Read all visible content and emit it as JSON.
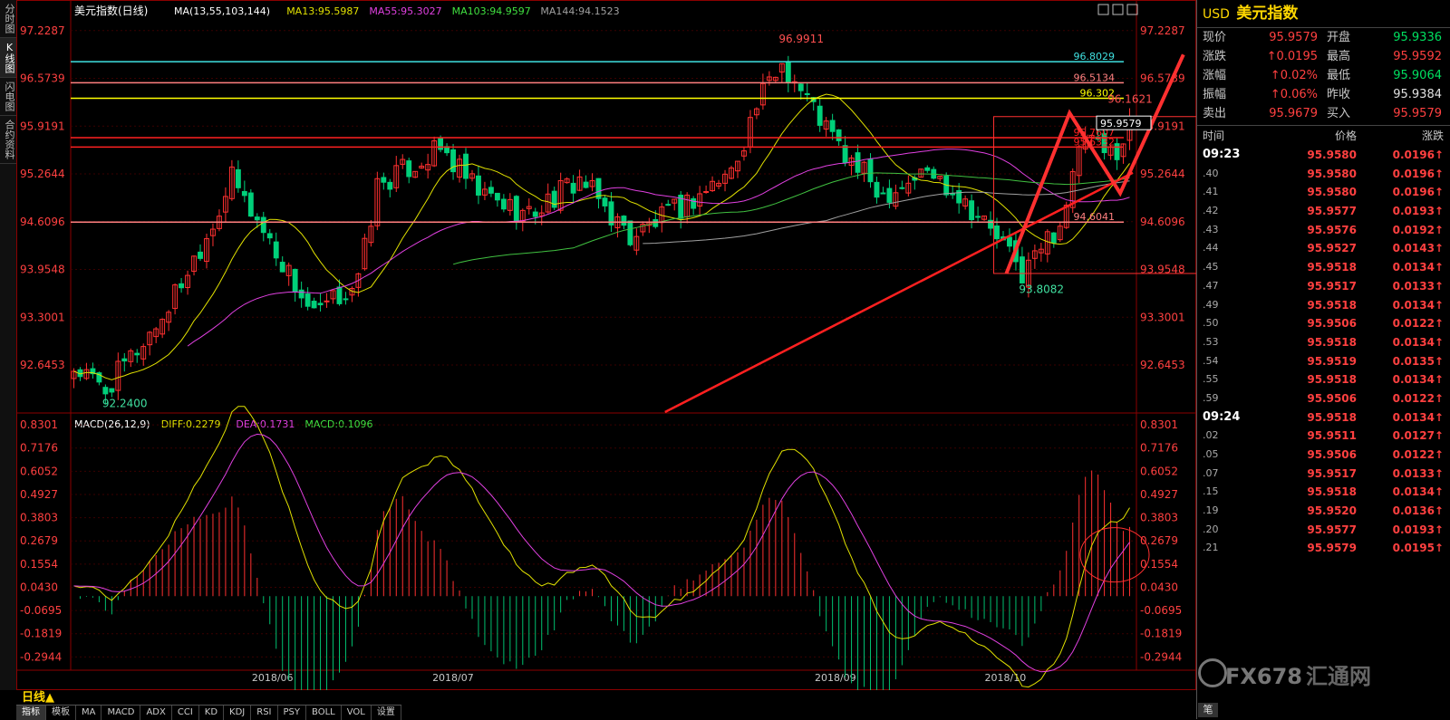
{
  "left_tabs": [
    "分时图",
    "K线图",
    "闪电图",
    "合约资料"
  ],
  "top_icons": [
    "window-icon",
    "restore-icon",
    "close-icon"
  ],
  "chart_data": [
    {
      "type": "candlestick",
      "title": "美元指数(日线)",
      "indicator_legend": [
        {
          "text": "MA(13,55,103,144)",
          "color": "#ffffff"
        },
        {
          "text": "MA13:95.5987",
          "color": "#e0e000"
        },
        {
          "text": "MA55:95.3027",
          "color": "#e040e0"
        },
        {
          "text": "MA103:94.9597",
          "color": "#40e040"
        },
        {
          "text": "MA144:94.1523",
          "color": "#a0a0a0"
        }
      ],
      "y_ticks": [
        "97.2287",
        "96.5739",
        "95.9191",
        "95.2644",
        "94.6096",
        "93.9548",
        "93.3001",
        "92.6453"
      ],
      "ylim": [
        92.0,
        97.4
      ],
      "x_labels": [
        "2018/06",
        "2018/07",
        "2018/09",
        "2018/10"
      ],
      "annotations": [
        {
          "text": "96.9911",
          "value": 96.9911
        },
        {
          "text": "92.2400",
          "value": 92.24
        },
        {
          "text": "93.8082",
          "value": 93.8082
        },
        {
          "text": "96.1621",
          "value": 96.1621
        }
      ],
      "horizontal_levels": [
        {
          "label": "96.8029",
          "value": 96.8029,
          "color": "#40e0e0"
        },
        {
          "label": "96.5134",
          "value": 96.5134,
          "color": "#ff8080"
        },
        {
          "label": "96.302",
          "value": 96.302,
          "color": "#ffff00"
        },
        {
          "label": "95.7607",
          "value": 95.7607,
          "color": "#ff2020"
        },
        {
          "label": "95.6332",
          "value": 95.6332,
          "color": "#ff2020"
        },
        {
          "label": "94.6041",
          "value": 94.6041,
          "color": "#ff8080"
        }
      ],
      "current_price_label": "95.9579",
      "colors": {
        "up": "#ff3030",
        "down": "#00d07a",
        "grid": "#8b0000"
      }
    },
    {
      "type": "macd",
      "legend": [
        {
          "text": "MACD(26,12,9)",
          "color": "#ffffff"
        },
        {
          "text": "DIFF:0.2279",
          "color": "#e0e000"
        },
        {
          "text": "DEA:0.1731",
          "color": "#e040e0"
        },
        {
          "text": "MACD:0.1096",
          "color": "#40e040"
        }
      ],
      "y_ticks": [
        "0.8301",
        "0.7176",
        "0.6052",
        "0.4927",
        "0.3803",
        "0.2679",
        "0.1554",
        "0.0430",
        "-0.0695",
        "-0.1819",
        "-0.2944"
      ],
      "ylim": [
        -0.35,
        0.87
      ]
    }
  ],
  "quote": {
    "code": "USD",
    "name": "美元指数",
    "rows": [
      {
        "l1": "现价",
        "v1": "95.9579",
        "c1": "up",
        "l2": "开盘",
        "v2": "95.9336",
        "c2": "grn"
      },
      {
        "l1": "涨跌",
        "v1": "↑0.0195",
        "c1": "up",
        "l2": "最高",
        "v2": "95.9592",
        "c2": "up"
      },
      {
        "l1": "涨幅",
        "v1": "↑0.02%",
        "c1": "up",
        "l2": "最低",
        "v2": "95.9064",
        "c2": "grn"
      },
      {
        "l1": "振幅",
        "v1": "↑0.06%",
        "c1": "up",
        "l2": "昨收",
        "v2": "95.9384",
        "c2": "wht"
      },
      {
        "l1": "卖出",
        "v1": "95.9679",
        "c1": "up",
        "l2": "买入",
        "v2": "95.9579",
        "c2": "up"
      }
    ],
    "table_headers": [
      "时间",
      "价格",
      "涨跌"
    ],
    "ticks": [
      {
        "t": "09:23",
        "full": true,
        "p": "95.9580",
        "c": "0.0196↑"
      },
      {
        "t": ".40",
        "full": false,
        "p": "95.9580",
        "c": "0.0196↑"
      },
      {
        "t": ".41",
        "full": false,
        "p": "95.9580",
        "c": "0.0196↑"
      },
      {
        "t": ".42",
        "full": false,
        "p": "95.9577",
        "c": "0.0193↑"
      },
      {
        "t": ".43",
        "full": false,
        "p": "95.9576",
        "c": "0.0192↑"
      },
      {
        "t": ".44",
        "full": false,
        "p": "95.9527",
        "c": "0.0143↑"
      },
      {
        "t": ".45",
        "full": false,
        "p": "95.9518",
        "c": "0.0134↑"
      },
      {
        "t": ".47",
        "full": false,
        "p": "95.9517",
        "c": "0.0133↑"
      },
      {
        "t": ".49",
        "full": false,
        "p": "95.9518",
        "c": "0.0134↑"
      },
      {
        "t": ".50",
        "full": false,
        "p": "95.9506",
        "c": "0.0122↑"
      },
      {
        "t": ".53",
        "full": false,
        "p": "95.9518",
        "c": "0.0134↑"
      },
      {
        "t": ".54",
        "full": false,
        "p": "95.9519",
        "c": "0.0135↑"
      },
      {
        "t": ".55",
        "full": false,
        "p": "95.9518",
        "c": "0.0134↑"
      },
      {
        "t": ".59",
        "full": false,
        "p": "95.9506",
        "c": "0.0122↑"
      },
      {
        "t": "09:24",
        "full": true,
        "p": "95.9518",
        "c": "0.0134↑"
      },
      {
        "t": ".02",
        "full": false,
        "p": "95.9511",
        "c": "0.0127↑"
      },
      {
        "t": ".05",
        "full": false,
        "p": "95.9506",
        "c": "0.0122↑"
      },
      {
        "t": ".07",
        "full": false,
        "p": "95.9517",
        "c": "0.0133↑"
      },
      {
        "t": ".15",
        "full": false,
        "p": "95.9518",
        "c": "0.0134↑"
      },
      {
        "t": ".19",
        "full": false,
        "p": "95.9520",
        "c": "0.0136↑"
      },
      {
        "t": ".20",
        "full": false,
        "p": "95.9577",
        "c": "0.0193↑"
      },
      {
        "t": ".21",
        "full": false,
        "p": "95.9579",
        "c": "0.0195↑"
      }
    ]
  },
  "bottom": {
    "period": "日线▲",
    "tabs": [
      "指标",
      "模板",
      "MA",
      "MACD",
      "ADX",
      "CCI",
      "KD",
      "KDJ",
      "RSI",
      "PSY",
      "BOLL",
      "VOL",
      "设置"
    ],
    "active_tab": "指标",
    "pen": "笔"
  },
  "watermark": {
    "brand": "FX678",
    "cn": "汇通网"
  }
}
